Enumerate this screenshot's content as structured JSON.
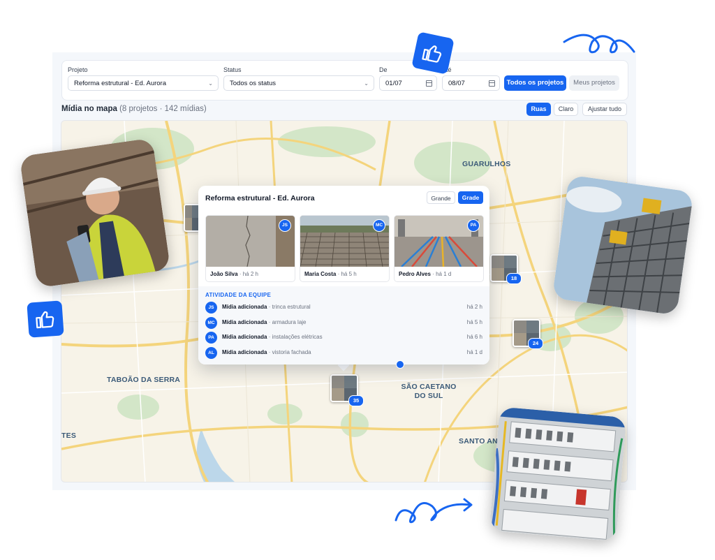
{
  "filters": {
    "project_label": "Projeto",
    "project_value": "Reforma estrutural - Ed. Aurora",
    "status_label": "Status",
    "status_value": "Todos os status",
    "from_label": "De",
    "from_value": "01/07",
    "to_label": "Até",
    "to_value": "08/07",
    "all_projects": "Todos os projetos",
    "my_projects": "Meus projetos"
  },
  "map_header": {
    "title": "Mídia no mapa",
    "subtitle": "(8 projetos · 142 mídias)",
    "streets": "Ruas",
    "light": "Claro",
    "fit_all": "Ajustar tudo"
  },
  "map": {
    "cities": [
      "GUARULHOS",
      "TABOÃO DA SERRA",
      "SÃO CAETANO\nDO SUL",
      "SANTO ANDRÉ",
      "TES"
    ],
    "clusters": [
      {
        "count": "18"
      },
      {
        "count": "24"
      },
      {
        "count": "35"
      }
    ]
  },
  "popup": {
    "title": "Reforma estrutural - Ed. Aurora",
    "view_large": "Grande",
    "view_grid": "Grade",
    "cards": [
      {
        "initials": "JS",
        "name": "João Silva",
        "time": "· há 2 h"
      },
      {
        "initials": "MC",
        "name": "Maria Costa",
        "time": "· há 5 h"
      },
      {
        "initials": "PA",
        "name": "Pedro Alves",
        "time": "· há 1 d"
      }
    ],
    "activity_title": "ATIVIDADE DA EQUIPE",
    "activity": [
      {
        "initials": "JS",
        "action": "Mídia adicionada",
        "detail": " · trinca estrutural",
        "time": "há 2 h"
      },
      {
        "initials": "MC",
        "action": "Mídia adicionada",
        "detail": " · armadura laje",
        "time": "há 5 h"
      },
      {
        "initials": "PA",
        "action": "Mídia adicionada",
        "detail": " · instalações elétricas",
        "time": "há 6 h"
      },
      {
        "initials": "AL",
        "action": "Mídia adicionada",
        "detail": " · vistoria fachada",
        "time": "há 1 d"
      }
    ]
  },
  "colors": {
    "accent": "#1765f0",
    "map_background": "#f7f3e8",
    "road_yellow": "#f6d77b",
    "park_green": "#cfe3c3",
    "water_blue": "#b8d6ea"
  },
  "icons": [
    "thumbs-up-icon",
    "chevron-down-icon",
    "calendar-icon",
    "squiggle-decoration",
    "arrow-squiggle-decoration"
  ]
}
